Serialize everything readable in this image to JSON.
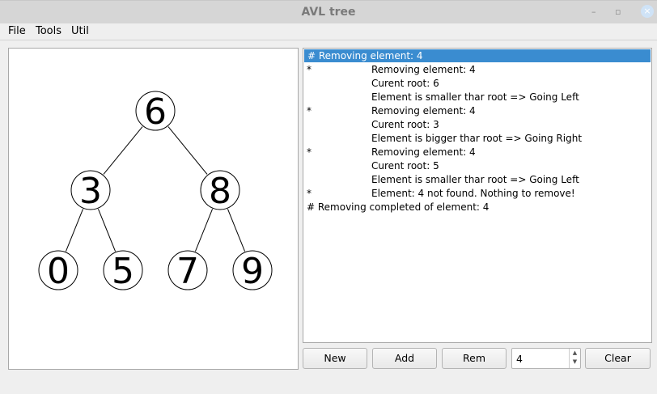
{
  "window": {
    "title": "AVL tree",
    "minimize": "–",
    "restore": "▫",
    "close": "×"
  },
  "menu": [
    "File",
    "Tools",
    "Util"
  ],
  "tree": {
    "nodes": [
      {
        "value": "6",
        "level": 0,
        "slot": 0
      },
      {
        "value": "3",
        "level": 1,
        "slot": 0
      },
      {
        "value": "8",
        "level": 1,
        "slot": 1
      },
      {
        "value": "0",
        "level": 2,
        "slot": 0
      },
      {
        "value": "5",
        "level": 2,
        "slot": 1
      },
      {
        "value": "7",
        "level": 2,
        "slot": 2
      },
      {
        "value": "9",
        "level": 2,
        "slot": 3
      }
    ],
    "edges": [
      [
        0,
        1
      ],
      [
        0,
        2
      ],
      [
        1,
        3
      ],
      [
        1,
        4
      ],
      [
        2,
        5
      ],
      [
        2,
        6
      ]
    ]
  },
  "log": [
    {
      "star": "",
      "text": "# Removing element: 4",
      "full": true,
      "selected": true
    },
    {
      "star": "*",
      "text": "Removing element: 4"
    },
    {
      "star": "",
      "text": "Curent root: 6"
    },
    {
      "star": "",
      "text": "Element is smaller thar root => Going Left"
    },
    {
      "star": "*",
      "text": "Removing element: 4"
    },
    {
      "star": "",
      "text": "Curent root: 3"
    },
    {
      "star": "",
      "text": "Element is bigger thar root => Going Right"
    },
    {
      "star": "*",
      "text": "Removing element: 4"
    },
    {
      "star": "",
      "text": "Curent root: 5"
    },
    {
      "star": "",
      "text": "Element is smaller thar root => Going Left"
    },
    {
      "star": "*",
      "text": "Element: 4 not found. Nothing to remove!"
    },
    {
      "star": "",
      "text": "# Removing completed of element: 4",
      "full": true
    }
  ],
  "buttons": {
    "new": "New",
    "add": "Add",
    "rem": "Rem",
    "clear": "Clear"
  },
  "spinbox": {
    "value": "4",
    "up": "▲",
    "down": "▼"
  }
}
